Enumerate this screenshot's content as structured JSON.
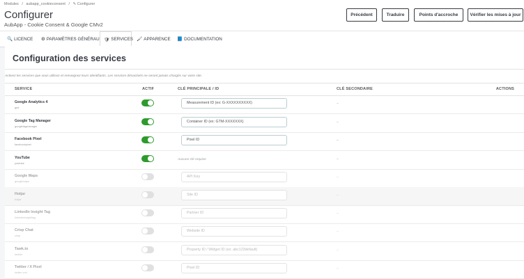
{
  "breadcrumb": [
    "Modules",
    "/",
    "aubapp_cookieconsent",
    "/",
    "✎ Configurer"
  ],
  "page": {
    "title": "Configurer",
    "subtitle": "AubApp - Cookie Consent & Google CMv2"
  },
  "toolbar": {
    "previous": "Précédent",
    "translate": "Traduire",
    "hooks": "Points d'accroche",
    "updates": "Vérifier les mises à jour"
  },
  "tabs": [
    {
      "label": "LICENCE",
      "icon": "🔍"
    },
    {
      "label": "PARAMÈTRES GÉNÉRAUX",
      "icon": "⚙"
    },
    {
      "label": "SERVICES",
      "icon": "🛡"
    },
    {
      "label": "APPARENCE",
      "icon": "🖌"
    },
    {
      "label": "DOCUMENTATION",
      "icon": "📘"
    }
  ],
  "section": {
    "title": "Configuration des services",
    "help": "Activez les services que vous utilisez et renseignez leurs identifiants. Les services désactivés ne seront jamais chargés sur votre site."
  },
  "columns": {
    "service": "SERVICE",
    "active": "ACTIF",
    "primary": "CLÉ PRINCIPALE / ID",
    "secondary": "CLÉ SECONDAIRE",
    "actions": "ACTIONS"
  },
  "services": [
    {
      "name": "Google Analytics 4",
      "key": "ga4",
      "active": true,
      "placeholder": "Measurement ID (ex: G-XXXXXXXXXX)",
      "secondary": "–"
    },
    {
      "name": "Google Tag Manager",
      "key": "googletagmanager",
      "active": true,
      "placeholder": "Container ID (ex: GTM-XXXXXXX)",
      "secondary": "–"
    },
    {
      "name": "Facebook Pixel",
      "key": "facebookpixel",
      "active": true,
      "placeholder": "Pixel ID",
      "secondary": "–"
    },
    {
      "name": "YouTube",
      "key": "youtube",
      "active": true,
      "nokey": "Aucune clé requise",
      "secondary": "–"
    },
    {
      "name": "Google Maps",
      "key": "googlemaps",
      "active": false,
      "placeholder": "API Key",
      "secondary": "–"
    },
    {
      "name": "Hotjar",
      "key": "hotjar",
      "active": false,
      "placeholder": "Site ID",
      "secondary": "–"
    },
    {
      "name": "LinkedIn Insight Tag",
      "key": "linkedininsighttag",
      "active": false,
      "placeholder": "Partner ID",
      "secondary": "–"
    },
    {
      "name": "Crisp Chat",
      "key": "crisp",
      "active": false,
      "placeholder": "Website ID",
      "secondary": "–"
    },
    {
      "name": "Tawk.to",
      "key": "tawkto",
      "active": false,
      "placeholder": "Property ID / Widget ID (ex: abc123default)",
      "secondary": "–"
    },
    {
      "name": "Twitter / X Pixel",
      "key": "twitter-xml",
      "active": false,
      "placeholder": "Pixel ID",
      "secondary": "–"
    }
  ],
  "colors": {
    "toggle_on": "#2e9a2e",
    "toggle_off": "#e0e0e0",
    "text_dark": "#363a41"
  }
}
